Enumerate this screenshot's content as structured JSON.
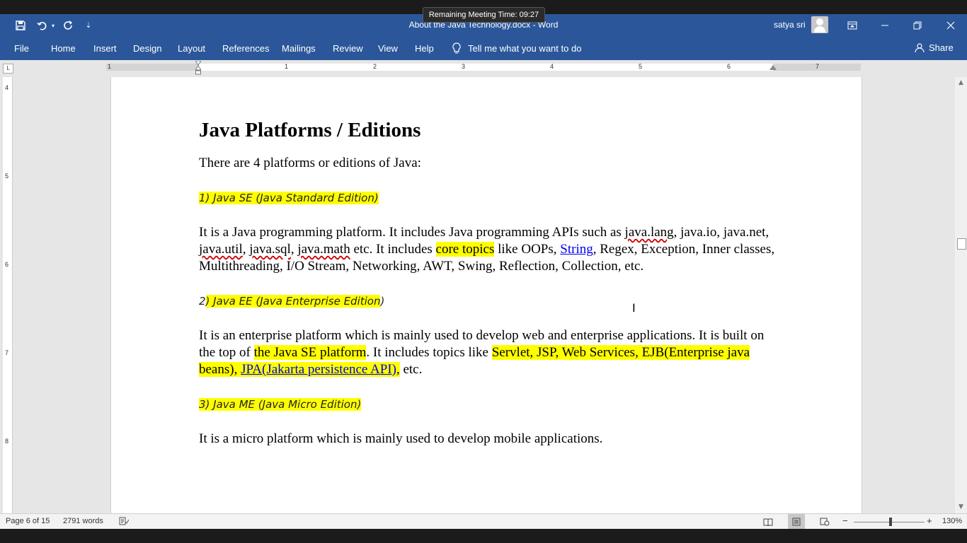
{
  "meeting": {
    "text": "Remaining Meeting Time: 09:27"
  },
  "titlebar": {
    "document_title": "About the Java Technology.docx  -  Word",
    "user_name": "satya sri",
    "accent_color": "#2b579a"
  },
  "quick_access": {
    "save_icon": "save-icon",
    "undo_icon": "undo-icon",
    "redo_icon": "repeat-icon",
    "customize_icon": "customize-icon"
  },
  "window": {
    "ribbon_display_icon": "ribbon-display-icon",
    "minimize_icon": "minimize-icon",
    "restore_icon": "restore-icon",
    "close_icon": "close-icon"
  },
  "ribbon": {
    "tabs": [
      "File",
      "Home",
      "Insert",
      "Design",
      "Layout",
      "References",
      "Mailings",
      "Review",
      "View",
      "Help"
    ],
    "tell_me": "Tell me what you want to do",
    "share": "Share"
  },
  "ruler": {
    "corner": "L",
    "h_numbers": [
      "1",
      "1",
      "2",
      "3",
      "4",
      "5",
      "6",
      "7"
    ],
    "v_numbers": [
      "4",
      "5",
      "6",
      "7",
      "8"
    ]
  },
  "document": {
    "heading": "Java Platforms / Editions",
    "intro": "There are 4 platforms or editions of Java:",
    "se": {
      "title": "1) Java SE (Java Standard Edition)",
      "t1": "It is a Java programming platform. It includes Java programming APIs such as ",
      "w_lang": "java.lang",
      "t2": ", java.io, java.net, ",
      "w_util": "java.util",
      "t3": ", ",
      "w_sql": "java.sql",
      "t4": ", ",
      "w_math": "java.math",
      "t5": " etc. It includes ",
      "core_topics": "core topics",
      "t6": " like OOPs, ",
      "string_link": "String",
      "t7": ", Regex, Exception, Inner classes, Multithreading, I/O Stream, Networking, AWT, Swing, Reflection, Collection, etc."
    },
    "ee": {
      "title_start": "2",
      "title_mid": ") Java EE (Java Enterprise Edition",
      "title_end": ")",
      "t1": "It is an enterprise platform which is mainly used to develop web and enterprise applications. It is built on the top of ",
      "hl1": "the Java SE platform",
      "t2": ". It includes topics like ",
      "hl2": "Servlet, JSP, Web Services, EJB(Enterprise java beans), ",
      "jpa_link": "JPA(Jakarta persistence API)",
      "hl3": ",",
      "t3": " etc."
    },
    "me": {
      "title": "3) Java ME (Java Micro Edition)",
      "t1": "It is a micro platform which is mainly used to develop mobile applications."
    },
    "highlight_color": "#ffff00",
    "link_color": "#0000ee"
  },
  "status": {
    "page": "Page 6 of 15",
    "words": "2791 words",
    "proofing_icon": "proofing-icon",
    "zoom": "130%",
    "zoom_minus": "−",
    "zoom_plus": "+"
  }
}
